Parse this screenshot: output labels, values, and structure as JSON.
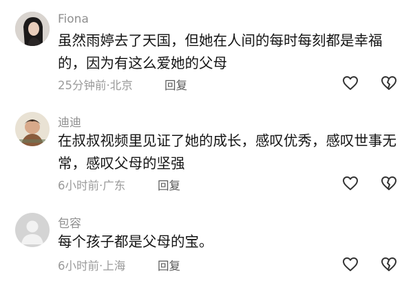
{
  "comments": [
    {
      "username": "Fiona",
      "text": "虽然雨婷去了天国，但她在人间的每时每刻都是幸福的，因为有这么爱她的父母",
      "time": "25分钟前",
      "location": "北京",
      "reply_label": "回复",
      "avatar": "photo-avatar-dark-hair"
    },
    {
      "username": "迪迪",
      "text": "在叔叔视频里见证了她的成长，感叹优秀，感叹世事无常，感叹父母的坚强",
      "time": "6小时前",
      "location": "广东",
      "reply_label": "回复",
      "avatar": "illustrated-avatar"
    },
    {
      "username": "包容",
      "text": "每个孩子都是父母的宝。",
      "time": "6小时前",
      "location": "上海",
      "reply_label": "回复",
      "avatar": "default-avatar"
    }
  ],
  "icons": {
    "like": "heart-icon",
    "dislike": "broken-heart-icon"
  },
  "colors": {
    "username": "#8f8f8f",
    "text": "#151515",
    "meta": "#9a9a9a",
    "icon": "#333333"
  }
}
